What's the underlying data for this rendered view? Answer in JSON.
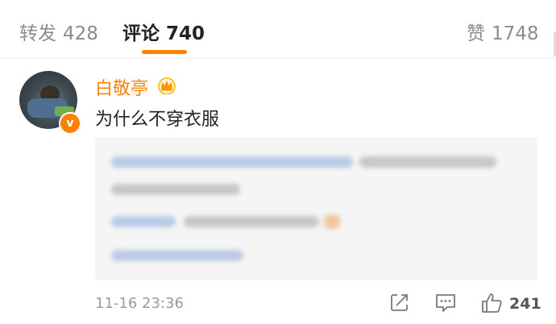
{
  "tabs": [
    {
      "label": "转发",
      "count": "428"
    },
    {
      "label": "评论",
      "count": "740"
    },
    {
      "label": "赞",
      "count": "1748"
    }
  ],
  "comment": {
    "username": "白敬亭",
    "text": "为什么不穿衣服",
    "time": "11-16 23:36",
    "like_count": "241"
  },
  "icons": [
    "crown-icon",
    "verified-badge-icon",
    "share-icon",
    "comment-icon",
    "like-icon"
  ],
  "colors": {
    "accent": "#ff8200",
    "muted": "#9b9b9b",
    "reply_bg": "#f5f5f5"
  }
}
